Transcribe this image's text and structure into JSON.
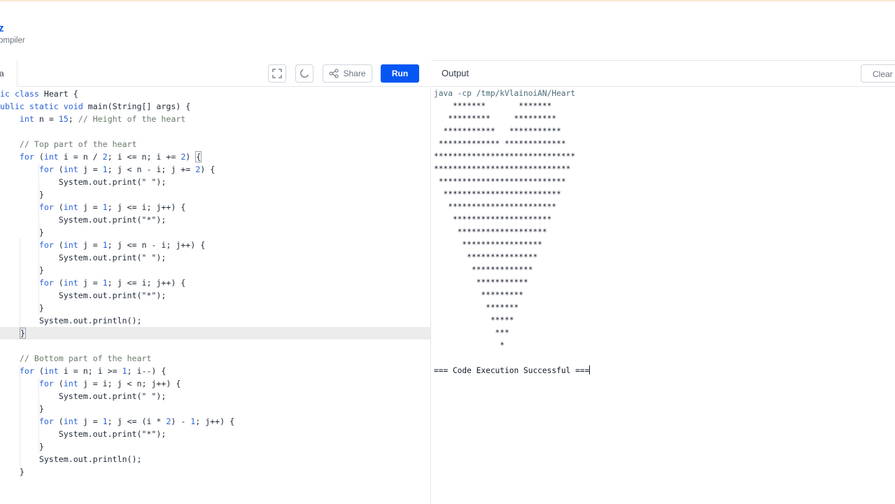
{
  "brand": {
    "name": "z",
    "subtitle": "ompiler"
  },
  "editor": {
    "file_tab": "a",
    "toolbar": {
      "fullscreen_icon": "expand-icon",
      "theme_icon": "moon-icon",
      "share_label": "Share",
      "run_label": "Run"
    },
    "code_lines": [
      "ic class Heart {",
      "ublic static void main(String[] args) {",
      "    int n = 15; // Height of the heart",
      "",
      "    // Top part of the heart",
      "    for (int i = n / 2; i <= n; i += 2) {",
      "        for (int j = 1; j < n - i; j += 2) {",
      "            System.out.print(\" \");",
      "        }",
      "        for (int j = 1; j <= i; j++) {",
      "            System.out.print(\"*\");",
      "        }",
      "        for (int j = 1; j <= n - i; j++) {",
      "            System.out.print(\" \");",
      "        }",
      "        for (int j = 1; j <= i; j++) {",
      "            System.out.print(\"*\");",
      "        }",
      "        System.out.println();",
      "    }",
      "",
      "    // Bottom part of the heart",
      "    for (int i = n; i >= 1; i--) {",
      "        for (int j = i; j < n; j++) {",
      "            System.out.print(\" \");",
      "        }",
      "        for (int j = 1; j <= (i * 2) - 1; j++) {",
      "            System.out.print(\"*\");",
      "        }",
      "        System.out.println();",
      "    }",
      ""
    ]
  },
  "output": {
    "title": "Output",
    "clear_label": "Clear",
    "lines": [
      "java -cp /tmp/kVlainoiAN/Heart",
      "    *******       *******",
      "   *********     *********",
      "  ***********   ***********",
      " ************* *************",
      "******************************",
      "*****************************",
      " ***************************",
      "  *************************",
      "   ***********************",
      "    *********************",
      "     *******************",
      "      *****************",
      "       ***************",
      "        *************",
      "         ***********",
      "          *********",
      "           *******",
      "            *****",
      "             ***",
      "              *",
      "",
      "=== Code Execution Successful ==="
    ]
  }
}
